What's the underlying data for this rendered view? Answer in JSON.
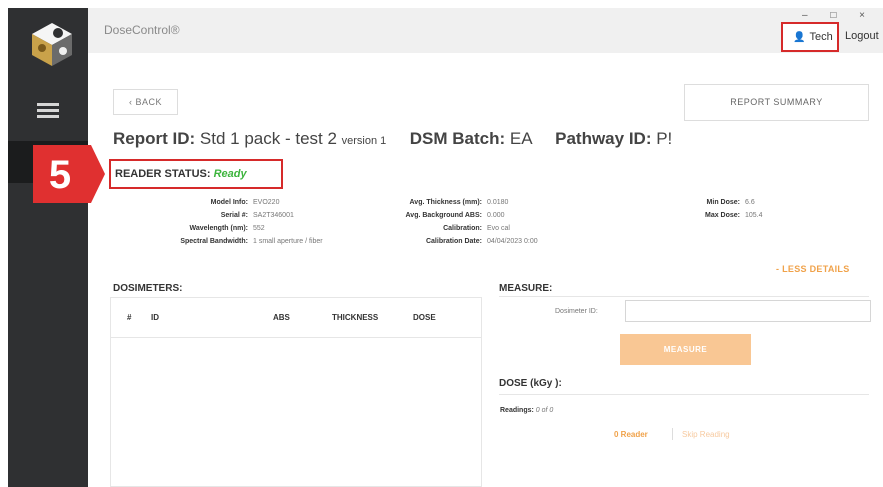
{
  "app": {
    "title": "DoseControl®"
  },
  "window_controls": {
    "text": "– □ ×"
  },
  "user": {
    "name": "Tech",
    "logout_label": "Logout"
  },
  "nav": {
    "back_label": "‹ BACK",
    "report_summary_label": "REPORT SUMMARY"
  },
  "report": {
    "id_label": "Report ID:",
    "id_value": "Std 1 pack - test 2",
    "version": "version 1",
    "batch_label": "DSM Batch:",
    "batch_value": "EA",
    "pathway_label": "Pathway ID:",
    "pathway_value": "P!"
  },
  "callout": {
    "number": "5"
  },
  "reader": {
    "status_label": "READER STATUS:",
    "status_value": "Ready",
    "status_color": "#3cb43c"
  },
  "details": {
    "col1": [
      {
        "label": "Model Info:",
        "value": "EVO220"
      },
      {
        "label": "Serial #:",
        "value": "SA2T346001"
      },
      {
        "label": "Wavelength (nm):",
        "value": "552"
      },
      {
        "label": "Spectral Bandwidth:",
        "value": "1 small aperture / fiber"
      }
    ],
    "col2": [
      {
        "label": "Avg. Thickness (mm):",
        "value": "0.0180"
      },
      {
        "label": "Avg. Background ABS:",
        "value": "0.000"
      },
      {
        "label": "Calibration:",
        "value": "Evo cal"
      },
      {
        "label": "Calibration Date:",
        "value": "04/04/2023 0:00"
      }
    ],
    "col3": [
      {
        "label": "Min Dose:",
        "value": "6.6"
      },
      {
        "label": "Max Dose:",
        "value": "105.4"
      }
    ],
    "less_details_label": "- LESS DETAILS"
  },
  "dosimeters": {
    "title": "DOSIMETERS:",
    "columns": [
      "#",
      "ID",
      "ABS",
      "THICKNESS",
      "DOSE"
    ]
  },
  "measure": {
    "title": "MEASURE:",
    "dosimeter_id_label": "Dosimeter ID:",
    "dosimeter_id_value": "",
    "measure_button": "MEASURE",
    "dose_title": "DOSE (kGy ):",
    "readings_label": "Readings:",
    "readings_value": "0 of 0",
    "reader_link": "0 Reader",
    "skip_link": "Skip Reading"
  },
  "colors": {
    "accent": "#f0a24a",
    "highlight": "#d62a2a",
    "sidebar": "#2f3032"
  }
}
